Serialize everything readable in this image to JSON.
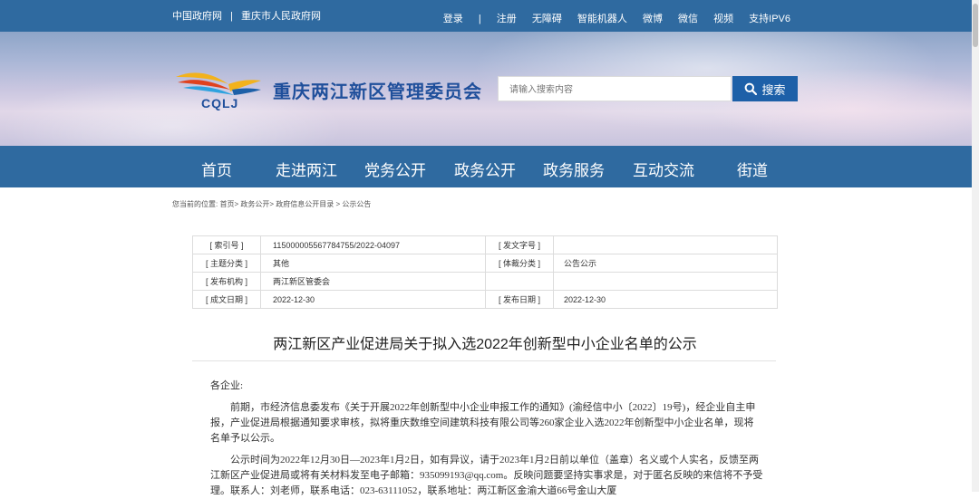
{
  "topbar": {
    "left_links": [
      "中国政府网",
      "重庆市人民政府网"
    ],
    "separator": "|",
    "right_links": [
      "登录",
      "注册",
      "无障碍",
      "智能机器人",
      "微博",
      "微信",
      "视频",
      "支持IPV6"
    ],
    "right_separator": "|"
  },
  "header": {
    "logo_text": "CQLJ",
    "site_title": "重庆两江新区管理委员会",
    "search_placeholder": "请输入搜索内容",
    "search_button": "搜索"
  },
  "nav": [
    "首页",
    "走进两江",
    "党务公开",
    "政务公开",
    "政务服务",
    "互动交流",
    "街道"
  ],
  "breadcrumb": "您当前的位置:  首页> 政务公开> 政府信息公开目录 > 公示公告",
  "info_table": {
    "rows": [
      [
        "[ 索引号 ]",
        "115000005567784755/2022-04097",
        "[ 发文字号 ]",
        ""
      ],
      [
        "[ 主题分类 ]",
        "其他",
        "[ 体裁分类 ]",
        "公告公示"
      ],
      [
        "[ 发布机构 ]",
        "两江新区管委会",
        "",
        ""
      ],
      [
        "[ 成文日期 ]",
        "2022-12-30",
        "[ 发布日期 ]",
        "2022-12-30"
      ]
    ]
  },
  "document": {
    "title": "两江新区产业促进局关于拟入选2022年创新型中小企业名单的公示",
    "greeting": "各企业:",
    "para1": "前期，市经济信息委发布《关于开展2022年创新型中小企业申报工作的通知》(渝经信中小〔2022〕19号)，经企业自主申报，产业促进局根据通知要求审核，拟将重庆数维空间建筑科技有限公司等260家企业入选2022年创新型中小企业名单，现将名单予以公示。",
    "para2": "公示时间为2022年12月30日—2023年1月2日，如有异议，请于2023年1月2日前以单位（盖章）名义或个人实名，反馈至两江新区产业促进局或将有关材料发至电子邮箱：935099193@qq.com。反映问题要坚持实事求是，对于匿名反映的来信将不予受理。联系人：刘老师，联系电话：023-63111052，联系地址：两江新区金渝大道66号金山大厦"
  },
  "colors": {
    "brand_blue": "#2f6aa0",
    "search_blue": "#1d60a8",
    "title_blue": "#1f4f9b"
  },
  "icons": [
    "logo-icon",
    "search-icon"
  ]
}
